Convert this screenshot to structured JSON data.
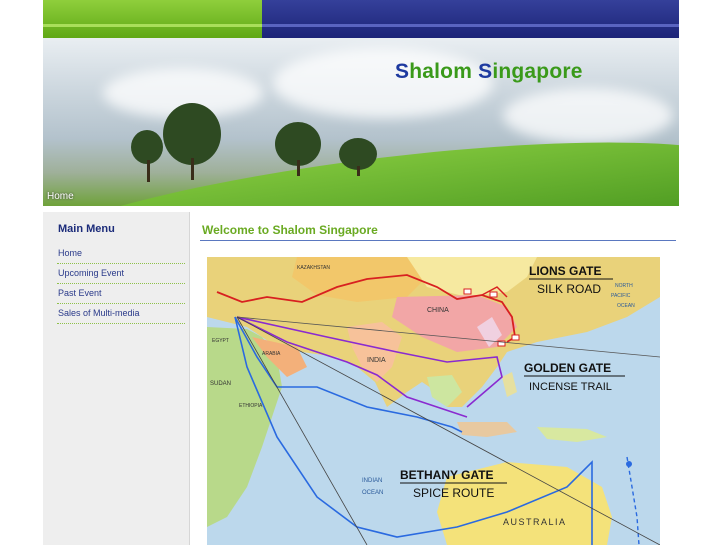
{
  "header": {
    "title_first_cap": "S",
    "title_part1": "halom ",
    "title_second_cap": "S",
    "title_part2": "ingapore",
    "breadcrumb": "Home"
  },
  "sidebar": {
    "title": "Main Menu",
    "items": [
      {
        "label": "Home"
      },
      {
        "label": "Upcoming Event"
      },
      {
        "label": "Past Event"
      },
      {
        "label": "Sales of Multi-media"
      }
    ]
  },
  "main": {
    "heading": "Welcome to Shalom Singapore",
    "map": {
      "gate1_title": "LIONS GATE",
      "gate1_sub": "SILK ROAD",
      "gate2_title": "GOLDEN GATE",
      "gate2_sub": "INCENSE TRAIL",
      "gate3_title": "BETHANY GATE",
      "gate3_sub": "SPICE ROUTE",
      "labels": {
        "kazakhstan": "KAZAKHSTAN",
        "china": "CHINA",
        "india": "INDIA",
        "egypt": "EGYPT",
        "arabia": "ARABIA",
        "sudan": "SUDAN",
        "ethiopia": "ETHIOPIA",
        "north": "NORTH",
        "pacific": "PACIFIC",
        "ocean": "OCEAN",
        "indian": "INDIAN",
        "ocean2": "OCEAN",
        "australia": "AUSTRALIA"
      }
    }
  },
  "colors": {
    "title_green": "#3a9a1a",
    "title_blue": "#1e3aa0",
    "silk_road": "#d82020",
    "incense_trail": "#8a2ad0",
    "spice_route": "#2a6ae0"
  }
}
